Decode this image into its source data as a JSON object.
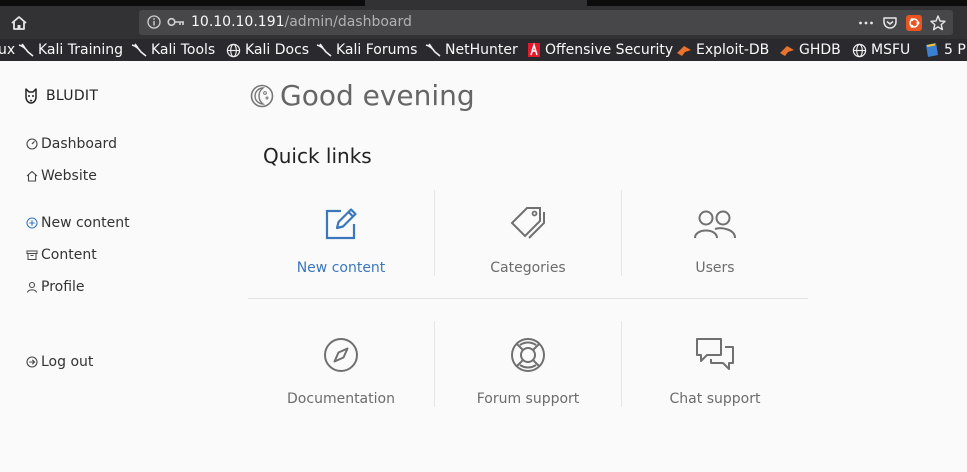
{
  "browser": {
    "url_host": "10.10.10.191",
    "url_path": "/admin/dashboard",
    "bookmarks": [
      {
        "label": "ux"
      },
      {
        "label": "Kali Training"
      },
      {
        "label": "Kali Tools"
      },
      {
        "label": "Kali Docs"
      },
      {
        "label": "Kali Forums"
      },
      {
        "label": "NetHunter"
      },
      {
        "label": "Offensive Security"
      },
      {
        "label": "Exploit-DB"
      },
      {
        "label": "GHDB"
      },
      {
        "label": "MSFU"
      },
      {
        "label": "5 P"
      }
    ]
  },
  "sidebar": {
    "brand": "BLUDIT",
    "items": [
      {
        "label": "Dashboard",
        "icon": "dashboard-icon"
      },
      {
        "label": "Website",
        "icon": "home-icon"
      },
      {
        "label": "New content",
        "icon": "plus-circle-icon"
      },
      {
        "label": "Content",
        "icon": "archive-icon"
      },
      {
        "label": "Profile",
        "icon": "person-icon"
      },
      {
        "label": "Log out",
        "icon": "arrow-circle-right-icon"
      }
    ]
  },
  "main": {
    "greeting": "Good evening",
    "quick_links_title": "Quick links",
    "links": [
      {
        "label": "New content",
        "icon": "edit-icon"
      },
      {
        "label": "Categories",
        "icon": "tags-icon"
      },
      {
        "label": "Users",
        "icon": "users-icon"
      },
      {
        "label": "Documentation",
        "icon": "compass-icon"
      },
      {
        "label": "Forum support",
        "icon": "lifebuoy-icon"
      },
      {
        "label": "Chat support",
        "icon": "chat-icon"
      }
    ]
  },
  "colors": {
    "accent": "#3a77bd",
    "muted": "#6c6c6c",
    "chrome": "#323234"
  }
}
